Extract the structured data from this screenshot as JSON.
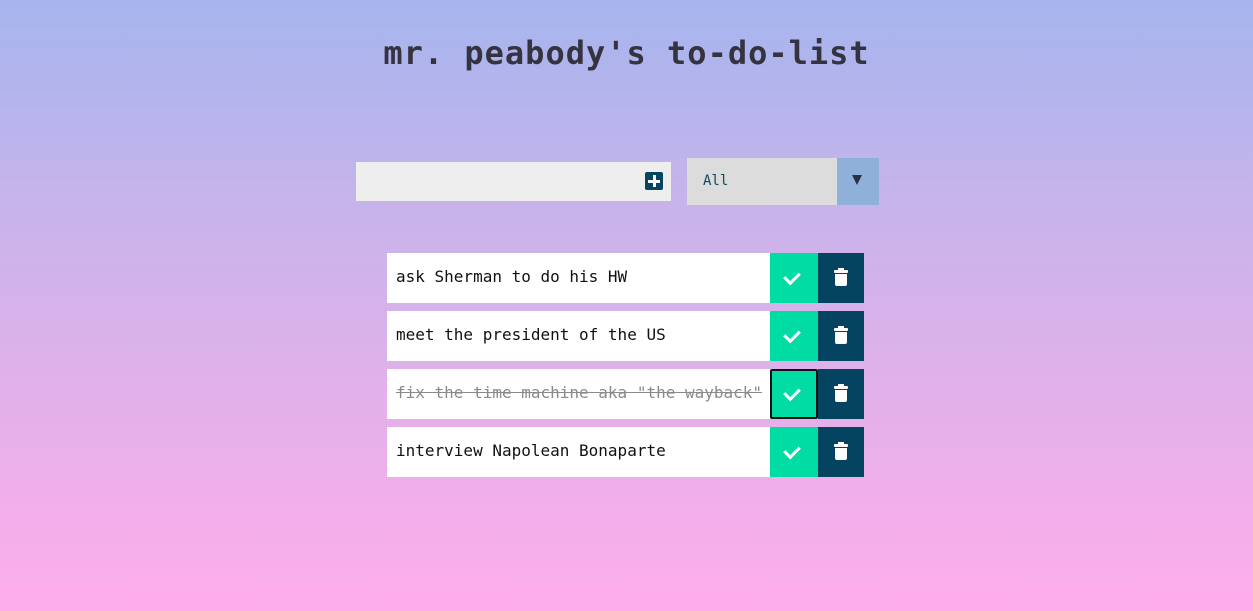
{
  "header": {
    "title": "mr. peabody's to-do-list"
  },
  "form": {
    "input_value": "",
    "input_placeholder": "",
    "add_icon": "plus-square-icon",
    "filter_selected": "All",
    "filter_arrow_icon": "caret-down-icon"
  },
  "todos": [
    {
      "text": "ask Sherman to do his HW",
      "completed": false
    },
    {
      "text": "meet the president of the US",
      "completed": false
    },
    {
      "text": "fix the time machine aka \"the wayback\"",
      "completed": true
    },
    {
      "text": "interview Napolean Bonaparte",
      "completed": false
    }
  ],
  "icons": {
    "complete": "check-icon",
    "delete": "trash-icon"
  },
  "colors": {
    "complete_button": "#00dca3",
    "delete_button": "#054461",
    "add_button": "#064560",
    "select_arrow_bg": "#8fb1d9",
    "gradient_top": "#a6b5ee",
    "gradient_bottom": "#ffadea"
  }
}
